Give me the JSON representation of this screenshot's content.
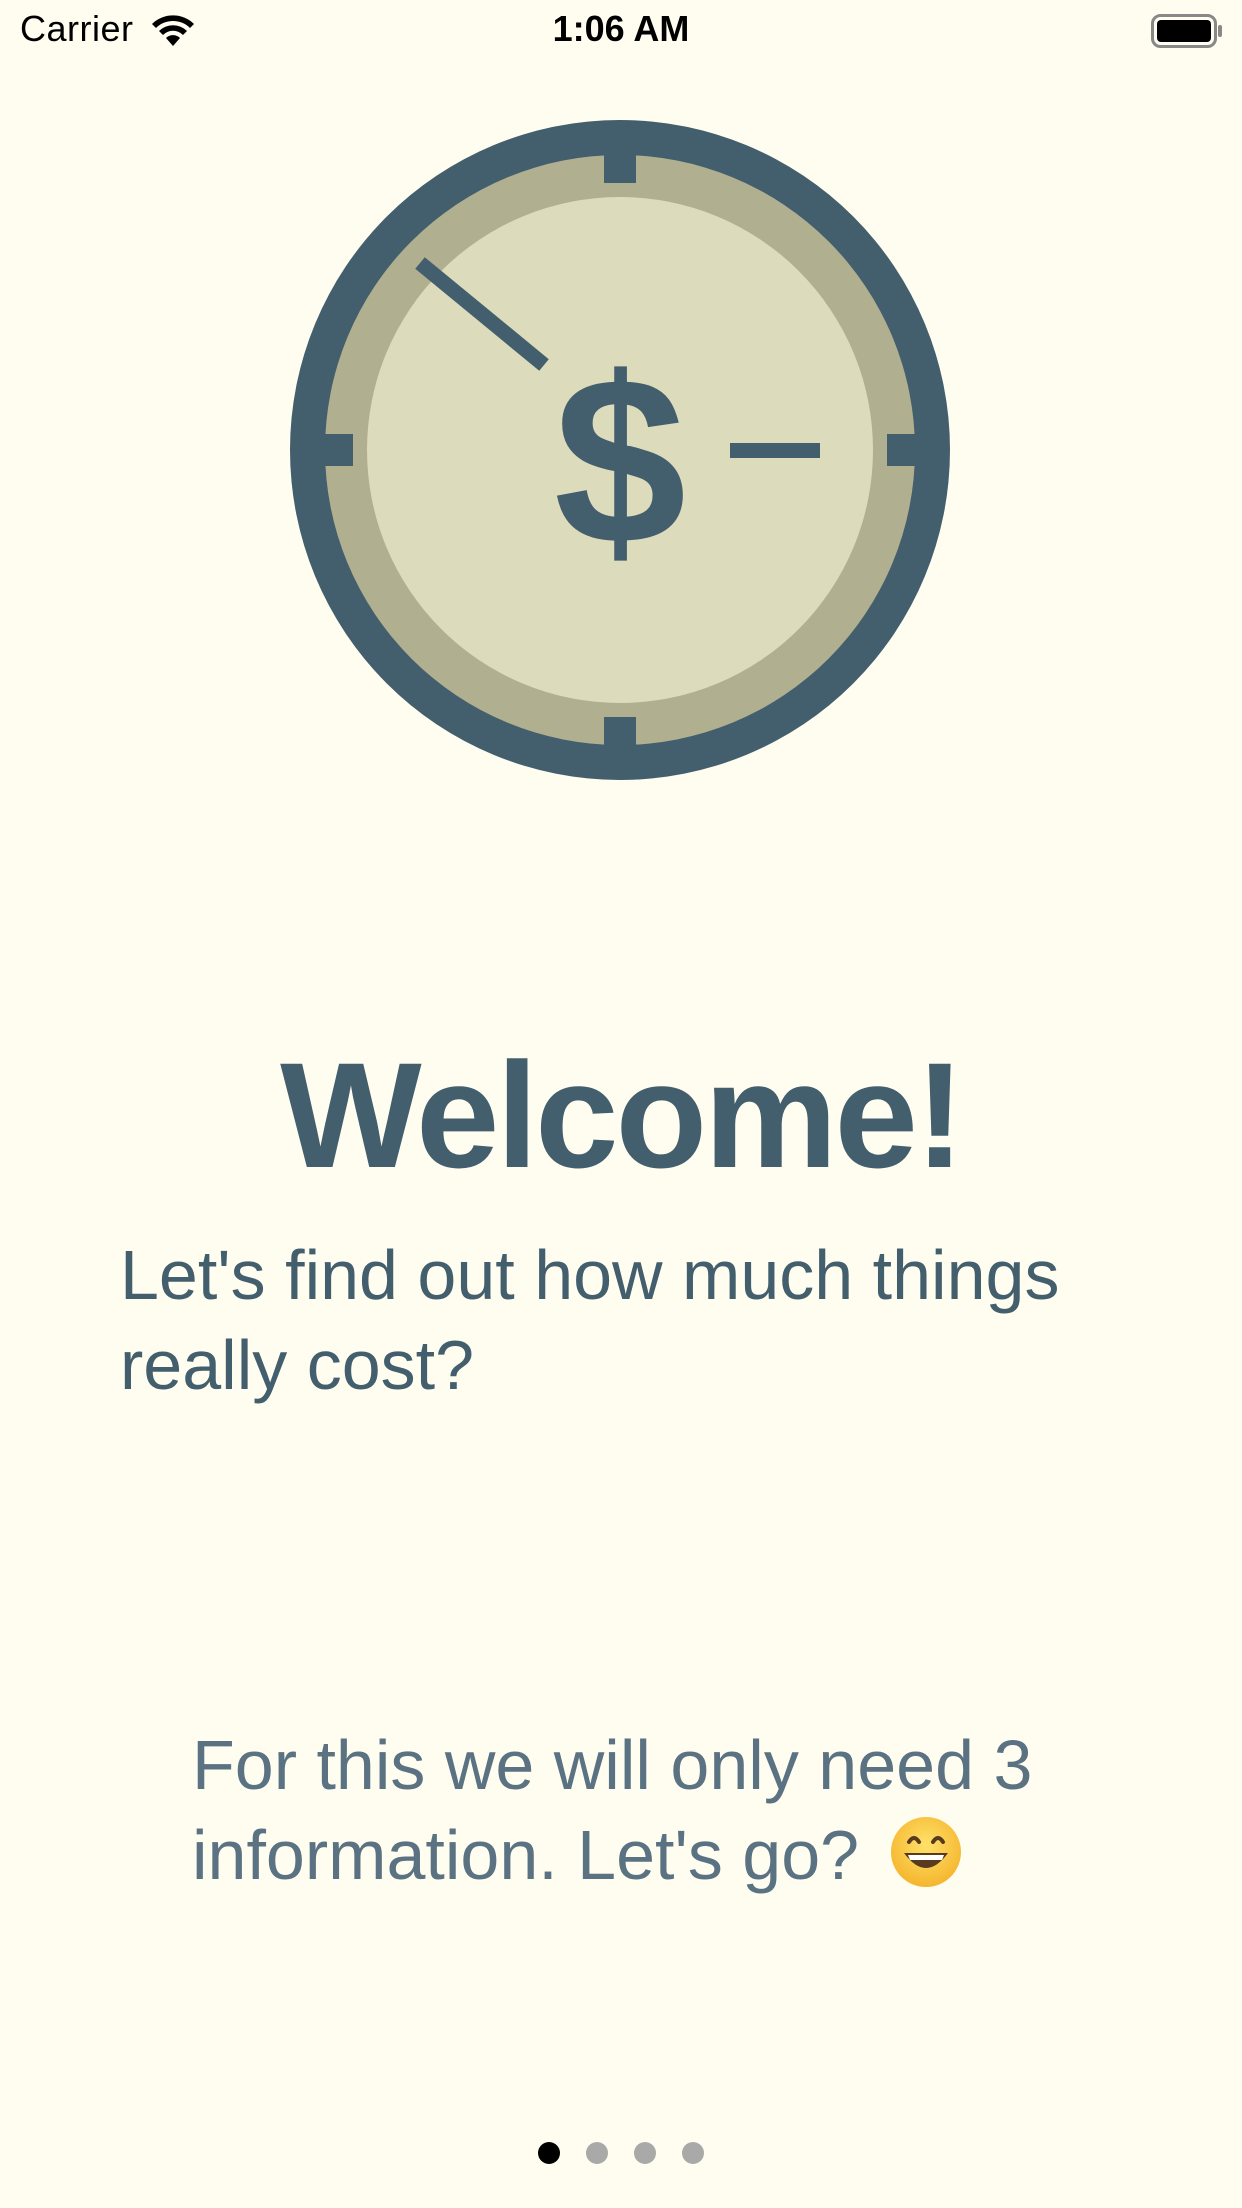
{
  "status_bar": {
    "carrier": "Carrier",
    "time": "1:06 AM",
    "wifi_icon": "wifi-icon",
    "battery_icon": "battery-icon"
  },
  "illustration": {
    "icon": "dollar-clock-icon",
    "symbol": "$",
    "colors": {
      "ring": "#435E6C",
      "rim": "#B0AF8F",
      "face": "#DCDBBB"
    }
  },
  "onboarding": {
    "title": "Welcome!",
    "subtitle": "Let's find out how much things really cost?",
    "note": "For this we will only need 3 information. Let's go?",
    "note_emoji": "grinning-face-icon"
  },
  "pager": {
    "pages": [
      "page 1",
      "page 2",
      "page 3",
      "page 4"
    ],
    "current_page": 1
  },
  "colors": {
    "background": "#FFFDF0",
    "text": "#435E6C"
  }
}
